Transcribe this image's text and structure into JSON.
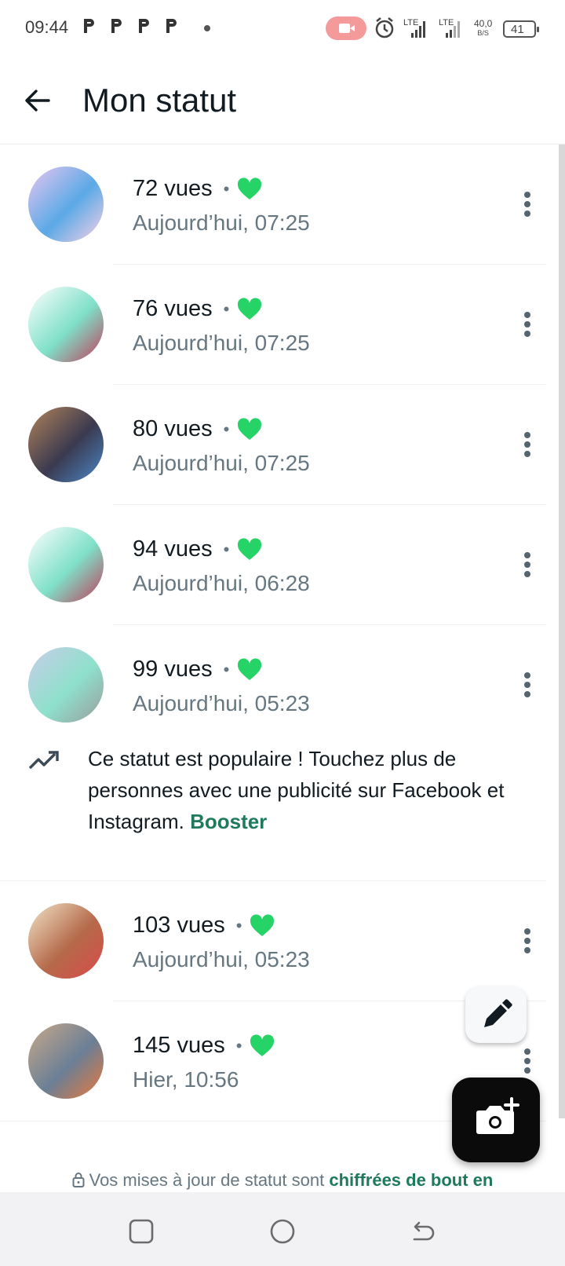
{
  "status_bar": {
    "time": "09:44",
    "lte1": "LTE",
    "lte2": "LTE",
    "speed_value": "40,0",
    "speed_unit": "B/S",
    "battery": "41"
  },
  "header": {
    "title": "Mon statut",
    "back_icon": "arrow-left-icon"
  },
  "statuses": [
    {
      "views": "72 vues",
      "separator": "•",
      "time": "Aujourd’hui, 07:25",
      "liked": true,
      "thumb_colors": [
        "#e9c6f0",
        "#5aa9e6",
        "#fbd1e6"
      ]
    },
    {
      "views": "76 vues",
      "separator": "•",
      "time": "Aujourd’hui, 07:25",
      "liked": true,
      "thumb_colors": [
        "#ffffff",
        "#7fe0c8",
        "#c23b5a"
      ]
    },
    {
      "views": "80 vues",
      "separator": "•",
      "time": "Aujourd’hui, 07:25",
      "liked": true,
      "thumb_colors": [
        "#b4845a",
        "#3a3a50",
        "#4d88c9"
      ]
    },
    {
      "views": "94 vues",
      "separator": "•",
      "time": "Aujourd’hui, 06:28",
      "liked": true,
      "thumb_colors": [
        "#ffffff",
        "#7fe0c8",
        "#c23b5a"
      ]
    },
    {
      "views": "99 vues",
      "separator": "•",
      "time": "Aujourd’hui, 05:23",
      "liked": true,
      "thumb_colors": [
        "#c9cde8",
        "#8ee0cc",
        "#9b9b9b"
      ]
    },
    {
      "views": "103 vues",
      "separator": "•",
      "time": "Aujourd’hui, 05:23",
      "liked": true,
      "thumb_colors": [
        "#f1e4c8",
        "#b56a4a",
        "#d94a4a"
      ]
    },
    {
      "views": "145 vues",
      "separator": "•",
      "time": "Hier, 10:56",
      "liked": true,
      "thumb_colors": [
        "#c9a98a",
        "#6b7f96",
        "#e87a3a"
      ]
    }
  ],
  "promo": {
    "icon": "trending-up-icon",
    "text": "Ce statut est populaire ! Touchez plus de personnes avec une publicité sur Facebook et Instagram. ",
    "link": "Booster"
  },
  "encryption": {
    "icon": "lock-icon",
    "text": "Vos mises à jour de statut sont ",
    "link": "chiffrées de bout en"
  },
  "fabs": {
    "pencil_icon": "pencil-icon",
    "camera_icon": "camera-add-icon"
  },
  "nav": [
    "recent-apps-icon",
    "home-icon",
    "back-icon"
  ],
  "colors": {
    "accent_green": "#25d366",
    "link_green": "#1f7a5c",
    "secondary_text": "#667781"
  }
}
